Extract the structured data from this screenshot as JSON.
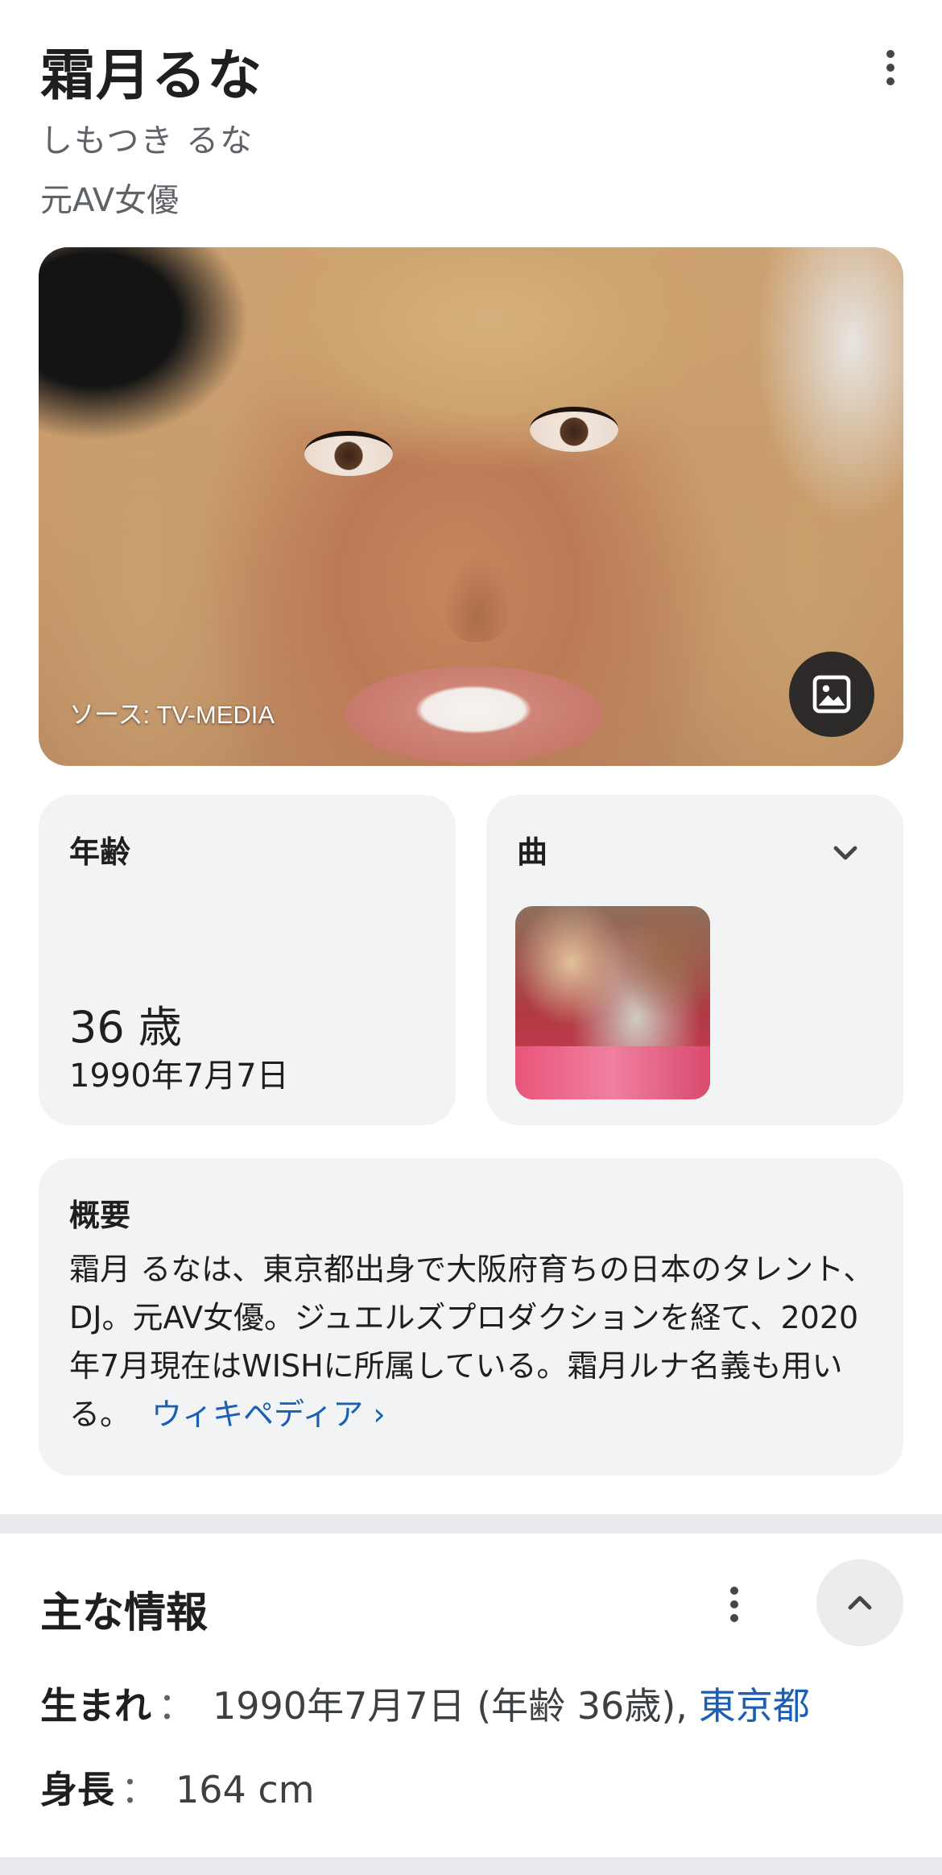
{
  "header": {
    "title": "霜月るな",
    "reading": "しもつき るな",
    "description": "元AV女優"
  },
  "hero": {
    "source": "ソース: TV-MEDIA"
  },
  "age_card": {
    "label": "年齢",
    "value": "36 歳",
    "date": "1990年7月7日"
  },
  "song_card": {
    "label": "曲"
  },
  "summary": {
    "label": "概要",
    "text": "霜月 るなは、東京都出身で大阪府育ちの日本のタレント、DJ。元AV女優。ジュエルズプロダクションを経て、2020年7月現在はWISHに所属している。霜月ルナ名義も用いる。",
    "link": "ウィキペディア ›"
  },
  "facts": {
    "title": "主な情報",
    "born_label": "生まれ",
    "sep": "：",
    "born_value": "1990年7月7日 (年齢 36歳),",
    "born_link": "東京都",
    "height_label": "身長",
    "height_value": "164 cm"
  },
  "colors": {
    "link": "#1a5fb4",
    "card_bg": "#f1f3f4",
    "secondary_text": "#5f6368"
  },
  "icons": {
    "more": "more-vert-icon",
    "image": "image-icon",
    "expand": "chevron-down-icon",
    "collapse": "chevron-up-icon"
  }
}
